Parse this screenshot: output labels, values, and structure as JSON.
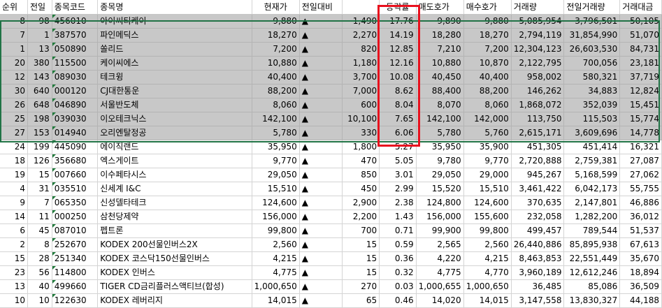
{
  "headers": [
    "순위",
    "전일",
    "종목코드",
    "종목명",
    "현재가",
    "전일대비",
    "",
    "등락률",
    "매도호가",
    "매수호가",
    "거래량",
    "전일거래량",
    "거래대금"
  ],
  "selected_count": 9,
  "arrow_glyph": "▲",
  "rows": [
    {
      "rank": "8",
      "prev": "98",
      "code": "456010",
      "name": "아이씨티케이",
      "price": "9,880",
      "change": "1,490",
      "rate": "17.76",
      "ask": "9,890",
      "bid": "9,880",
      "volume": "5,085,954",
      "prev_volume": "3,796,501",
      "amount": "50,105"
    },
    {
      "rank": "7",
      "prev": "1",
      "code": "387570",
      "name": "파인메딕스",
      "price": "18,270",
      "change": "2,270",
      "rate": "14.19",
      "ask": "18,280",
      "bid": "18,270",
      "volume": "2,794,119",
      "prev_volume": "31,854,990",
      "amount": "51,070"
    },
    {
      "rank": "1",
      "prev": "13",
      "code": "050890",
      "name": "쏠리드",
      "price": "7,200",
      "change": "820",
      "rate": "12.85",
      "ask": "7,210",
      "bid": "7,200",
      "volume": "12,304,123",
      "prev_volume": "26,603,530",
      "amount": "84,731"
    },
    {
      "rank": "20",
      "prev": "380",
      "code": "115500",
      "name": "케이씨에스",
      "price": "10,880",
      "change": "1,180",
      "rate": "12.16",
      "ask": "10,880",
      "bid": "10,870",
      "volume": "2,122,795",
      "prev_volume": "700,056",
      "amount": "23,181"
    },
    {
      "rank": "12",
      "prev": "143",
      "code": "089030",
      "name": "테크윙",
      "price": "40,400",
      "change": "3,700",
      "rate": "10.08",
      "ask": "40,450",
      "bid": "40,400",
      "volume": "958,002",
      "prev_volume": "580,321",
      "amount": "37,719"
    },
    {
      "rank": "30",
      "prev": "640",
      "code": "000120",
      "name": "CJ대한통운",
      "price": "88,200",
      "change": "7,000",
      "rate": "8.62",
      "ask": "88,400",
      "bid": "88,200",
      "volume": "146,262",
      "prev_volume": "34,883",
      "amount": "12,824"
    },
    {
      "rank": "26",
      "prev": "648",
      "code": "046890",
      "name": "서울반도체",
      "price": "8,060",
      "change": "600",
      "rate": "8.04",
      "ask": "8,070",
      "bid": "8,060",
      "volume": "1,868,072",
      "prev_volume": "352,039",
      "amount": "15,451"
    },
    {
      "rank": "25",
      "prev": "198",
      "code": "039030",
      "name": "이오테크닉스",
      "price": "142,100",
      "change": "10,100",
      "rate": "7.65",
      "ask": "142,100",
      "bid": "142,000",
      "volume": "113,750",
      "prev_volume": "115,503",
      "amount": "15,774"
    },
    {
      "rank": "27",
      "prev": "153",
      "code": "014940",
      "name": "오리엔탈정공",
      "price": "5,780",
      "change": "330",
      "rate": "6.06",
      "ask": "5,780",
      "bid": "5,760",
      "volume": "2,615,171",
      "prev_volume": "3,609,696",
      "amount": "14,778"
    },
    {
      "rank": "24",
      "prev": "199",
      "code": "445090",
      "name": "에이직랜드",
      "price": "35,950",
      "change": "1,800",
      "rate": "5.27",
      "ask": "35,950",
      "bid": "35,900",
      "volume": "451,305",
      "prev_volume": "451,414",
      "amount": "16,321"
    },
    {
      "rank": "18",
      "prev": "126",
      "code": "356680",
      "name": "엑스게이트",
      "price": "9,770",
      "change": "470",
      "rate": "5.05",
      "ask": "9,780",
      "bid": "9,770",
      "volume": "2,720,888",
      "prev_volume": "2,759,381",
      "amount": "27,087"
    },
    {
      "rank": "19",
      "prev": "15",
      "code": "007660",
      "name": "이수페타시스",
      "price": "29,050",
      "change": "850",
      "rate": "3.01",
      "ask": "29,050",
      "bid": "29,000",
      "volume": "945,267",
      "prev_volume": "5,168,599",
      "amount": "27,062"
    },
    {
      "rank": "4",
      "prev": "31",
      "code": "035510",
      "name": "신세계 I&C",
      "price": "15,510",
      "change": "450",
      "rate": "2.99",
      "ask": "15,520",
      "bid": "15,510",
      "volume": "3,461,422",
      "prev_volume": "6,042,173",
      "amount": "55,755"
    },
    {
      "rank": "9",
      "prev": "7",
      "code": "065350",
      "name": "신성델타테크",
      "price": "124,600",
      "change": "2,900",
      "rate": "2.38",
      "ask": "124,800",
      "bid": "124,600",
      "volume": "370,635",
      "prev_volume": "2,147,801",
      "amount": "46,886"
    },
    {
      "rank": "14",
      "prev": "11",
      "code": "000250",
      "name": "삼천당제약",
      "price": "156,000",
      "change": "2,200",
      "rate": "1.43",
      "ask": "156,000",
      "bid": "155,600",
      "volume": "232,058",
      "prev_volume": "1,282,200",
      "amount": "36,012"
    },
    {
      "rank": "6",
      "prev": "45",
      "code": "087010",
      "name": "펩트론",
      "price": "99,800",
      "change": "700",
      "rate": "0.71",
      "ask": "99,900",
      "bid": "99,800",
      "volume": "499,457",
      "prev_volume": "789,544",
      "amount": "51,537"
    },
    {
      "rank": "2",
      "prev": "8",
      "code": "252670",
      "name": "KODEX 200선물인버스2X",
      "price": "2,560",
      "change": "15",
      "rate": "0.59",
      "ask": "2,565",
      "bid": "2,560",
      "volume": "26,440,886",
      "prev_volume": "85,895,938",
      "amount": "67,613"
    },
    {
      "rank": "15",
      "prev": "28",
      "code": "251340",
      "name": "KODEX 코스닥150선물인버스",
      "price": "4,215",
      "change": "15",
      "rate": "0.36",
      "ask": "4,220",
      "bid": "4,215",
      "volume": "8,463,853",
      "prev_volume": "22,551,449",
      "amount": "35,670"
    },
    {
      "rank": "23",
      "prev": "56",
      "code": "114800",
      "name": "KODEX 인버스",
      "price": "4,775",
      "change": "15",
      "rate": "0.32",
      "ask": "4,775",
      "bid": "4,770",
      "volume": "3,960,189",
      "prev_volume": "12,612,246",
      "amount": "18,894"
    },
    {
      "rank": "13",
      "prev": "40",
      "code": "499660",
      "name": "TIGER CD금리플러스액티브(합성)",
      "price": "1,000,650",
      "change": "270",
      "rate": "0.03",
      "ask": "1,000,655",
      "bid": "1,000,650",
      "volume": "36,485",
      "prev_volume": "85,086",
      "amount": "36,509"
    },
    {
      "rank": "10",
      "prev": "10",
      "code": "122630",
      "name": "KODEX 레버리지",
      "price": "14,015",
      "change": "65",
      "rate": "0.46",
      "ask": "14,020",
      "bid": "14,015",
      "volume": "3,147,558",
      "prev_volume": "13,830,327",
      "amount": "44,188"
    }
  ]
}
